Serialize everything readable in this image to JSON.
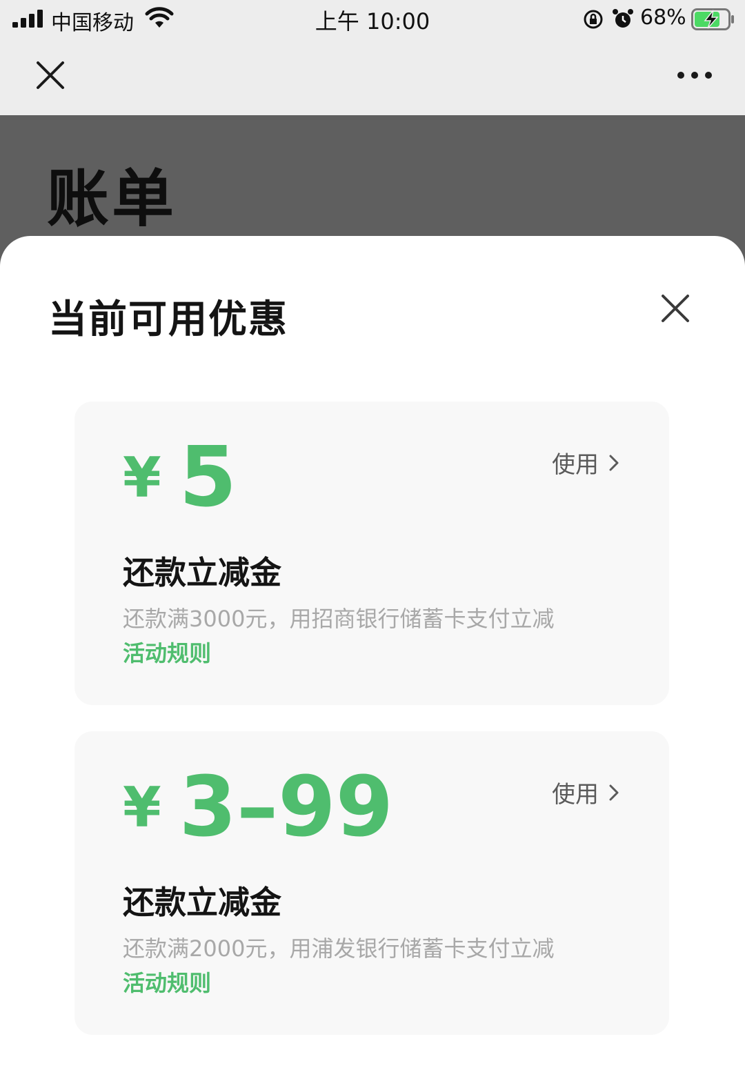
{
  "status_bar": {
    "carrier": "中国移动",
    "time": "上午 10:00",
    "battery_percent": "68%"
  },
  "nav": {
    "close_icon": "close-icon",
    "more_icon": "more-icon"
  },
  "page": {
    "title": "账单"
  },
  "sheet": {
    "title": "当前可用优惠",
    "close_icon": "close-icon"
  },
  "coupons": [
    {
      "currency": "¥",
      "amount": "5",
      "use_label": "使用",
      "name": "还款立减金",
      "description": "还款满3000元，用招商银行储蓄卡支付立减",
      "rules_label": "活动规则"
    },
    {
      "currency": "¥",
      "amount": "3–99",
      "use_label": "使用",
      "name": "还款立减金",
      "description": "还款满2000元，用浦发银行储蓄卡支付立减",
      "rules_label": "活动规则"
    }
  ],
  "colors": {
    "accent_green": "#4fbd6e",
    "overlay_gray": "#5f5f5f",
    "nav_bg": "#ededed"
  }
}
